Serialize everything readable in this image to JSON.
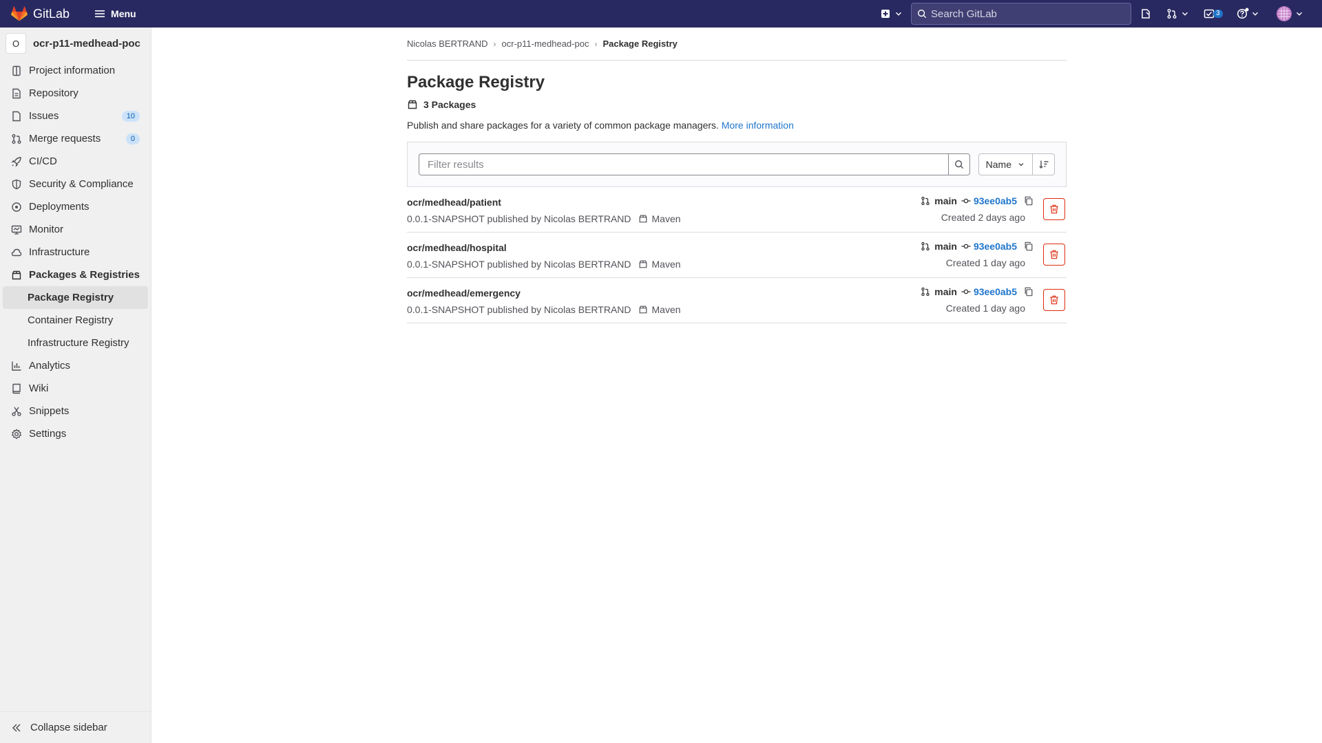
{
  "topbar": {
    "brand": "GitLab",
    "menu_label": "Menu",
    "search_placeholder": "Search GitLab",
    "todo_count": "3"
  },
  "sidebar": {
    "project_avatar_letter": "O",
    "project_name": "ocr-p11-medhead-poc",
    "items": [
      {
        "label": "Project information",
        "icon": "project-icon"
      },
      {
        "label": "Repository",
        "icon": "repository-icon"
      },
      {
        "label": "Issues",
        "icon": "issues-icon",
        "count": "10"
      },
      {
        "label": "Merge requests",
        "icon": "merge-request-icon",
        "count": "0"
      },
      {
        "label": "CI/CD",
        "icon": "rocket-icon"
      },
      {
        "label": "Security & Compliance",
        "icon": "shield-icon"
      },
      {
        "label": "Deployments",
        "icon": "deployments-icon"
      },
      {
        "label": "Monitor",
        "icon": "monitor-icon"
      },
      {
        "label": "Infrastructure",
        "icon": "cloud-icon"
      },
      {
        "label": "Packages & Registries",
        "icon": "package-icon"
      }
    ],
    "sub_items": [
      "Package Registry",
      "Container Registry",
      "Infrastructure Registry"
    ],
    "items_after": [
      {
        "label": "Analytics",
        "icon": "chart-icon"
      },
      {
        "label": "Wiki",
        "icon": "book-icon"
      },
      {
        "label": "Snippets",
        "icon": "snippet-icon"
      },
      {
        "label": "Settings",
        "icon": "settings-icon"
      }
    ],
    "collapse_label": "Collapse sidebar"
  },
  "breadcrumb": [
    "Nicolas BERTRAND",
    "ocr-p11-medhead-poc",
    "Package Registry"
  ],
  "page": {
    "title": "Package Registry",
    "package_count": "3 Packages",
    "description": "Publish and share packages for a variety of common package managers.",
    "more_info": "More information",
    "filter_placeholder": "Filter results",
    "sort_label": "Name"
  },
  "packages": [
    {
      "name": "ocr/medhead/patient",
      "version_text": "0.0.1-SNAPSHOT published by Nicolas BERTRAND",
      "type": "Maven",
      "branch": "main",
      "commit": "93ee0ab5",
      "created": "Created 2 days ago"
    },
    {
      "name": "ocr/medhead/hospital",
      "version_text": "0.0.1-SNAPSHOT published by Nicolas BERTRAND",
      "type": "Maven",
      "branch": "main",
      "commit": "93ee0ab5",
      "created": "Created 1 day ago"
    },
    {
      "name": "ocr/medhead/emergency",
      "version_text": "0.0.1-SNAPSHOT published by Nicolas BERTRAND",
      "type": "Maven",
      "branch": "main",
      "commit": "93ee0ab5",
      "created": "Created 1 day ago"
    }
  ]
}
